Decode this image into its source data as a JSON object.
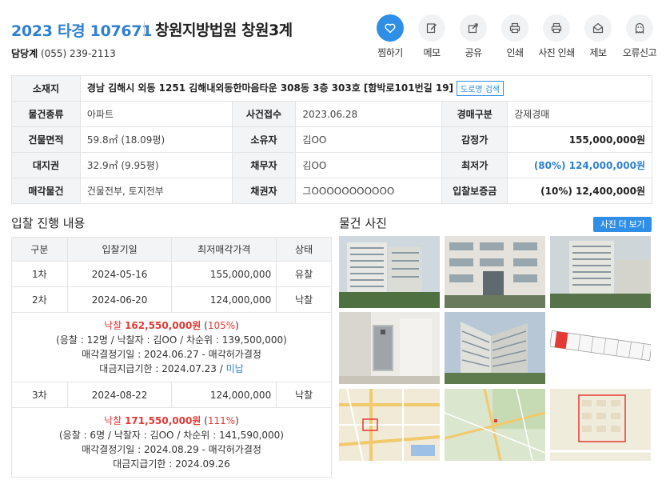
{
  "header": {
    "case_no": "2023 타경 107671",
    "court": "창원지방법원 창원3계",
    "manager_label": "담당계",
    "manager_phone": "(055) 239-2113"
  },
  "actions": [
    {
      "label": "찜하기",
      "icon": "heart-icon"
    },
    {
      "label": "메모",
      "icon": "edit-icon"
    },
    {
      "label": "공유",
      "icon": "share-icon"
    },
    {
      "label": "인쇄",
      "icon": "print-icon"
    },
    {
      "label": "사진 인쇄",
      "icon": "print-icon"
    },
    {
      "label": "제보",
      "icon": "mail-icon"
    },
    {
      "label": "오류신고",
      "icon": "ghost-icon"
    }
  ],
  "info": {
    "address_label": "소재지",
    "address": "경남 김해시 외동 1251 김해내외동한마음타운 308동 3층 303호 [함박로101번길 19]",
    "road_btn": "도로명 검색",
    "type_label": "물건종류",
    "type": "아파트",
    "filed_label": "사건접수",
    "filed": "2023.06.28",
    "auction_type_label": "경매구분",
    "auction_type": "강제경매",
    "area_label": "건물면적",
    "area": "59.8㎡ (18.09평)",
    "owner_label": "소유자",
    "owner": "김OO",
    "appraisal_label": "감정가",
    "appraisal": "155,000,000원",
    "land_label": "대지권",
    "land": "32.9㎡ (9.95평)",
    "debtor_label": "채무자",
    "debtor": "김OO",
    "minimum_label": "최저가",
    "minimum": "(80%) 124,000,000원",
    "sale_label": "매각물건",
    "sale": "건물전부, 토지전부",
    "creditor_label": "채권자",
    "creditor": "그OOOOOOOOOOO",
    "deposit_label": "입찰보증금",
    "deposit": "(10%) 12,400,000원"
  },
  "bid_section": {
    "title": "입찰 진행 내용",
    "headers": [
      "구분",
      "입찰기일",
      "최저매각가격",
      "상태"
    ],
    "rounds": [
      {
        "round": "1차",
        "date": "2024-05-16",
        "price": "155,000,000",
        "status": "유찰"
      },
      {
        "round": "2차",
        "date": "2024-06-20",
        "price": "124,000,000",
        "status": "낙찰"
      },
      {
        "round": "3차",
        "date": "2024-08-22",
        "price": "124,000,000",
        "status": "낙찰"
      }
    ],
    "result2": {
      "label": "낙찰",
      "amount": "162,550,000원",
      "pct": "105%",
      "line2": "(응찰 : 12명 / 낙찰자 : 김OO / 차순위 : 139,500,000)",
      "line3": "매각결정기일 : 2024.06.27 - 매각허가결정",
      "line4": "대금지급기한 : 2024.07.23 /",
      "line4_link": "미납"
    },
    "result3": {
      "label": "낙찰",
      "amount": "171,550,000원",
      "pct": "111%",
      "line2": "(응찰 : 6명 / 낙찰자 : 김OO / 차순위 : 141,590,000)",
      "line3": "매각결정기일 : 2024.08.29 - 매각허가결정",
      "line4": "대금지급기한 : 2024.09.26"
    }
  },
  "photo_section": {
    "title": "물건 사진",
    "more_btn": "사진 더 보기"
  },
  "colors": {
    "accent": "#2f80d1",
    "accent_bg": "#2f8fe6",
    "sold": "#e53935"
  }
}
